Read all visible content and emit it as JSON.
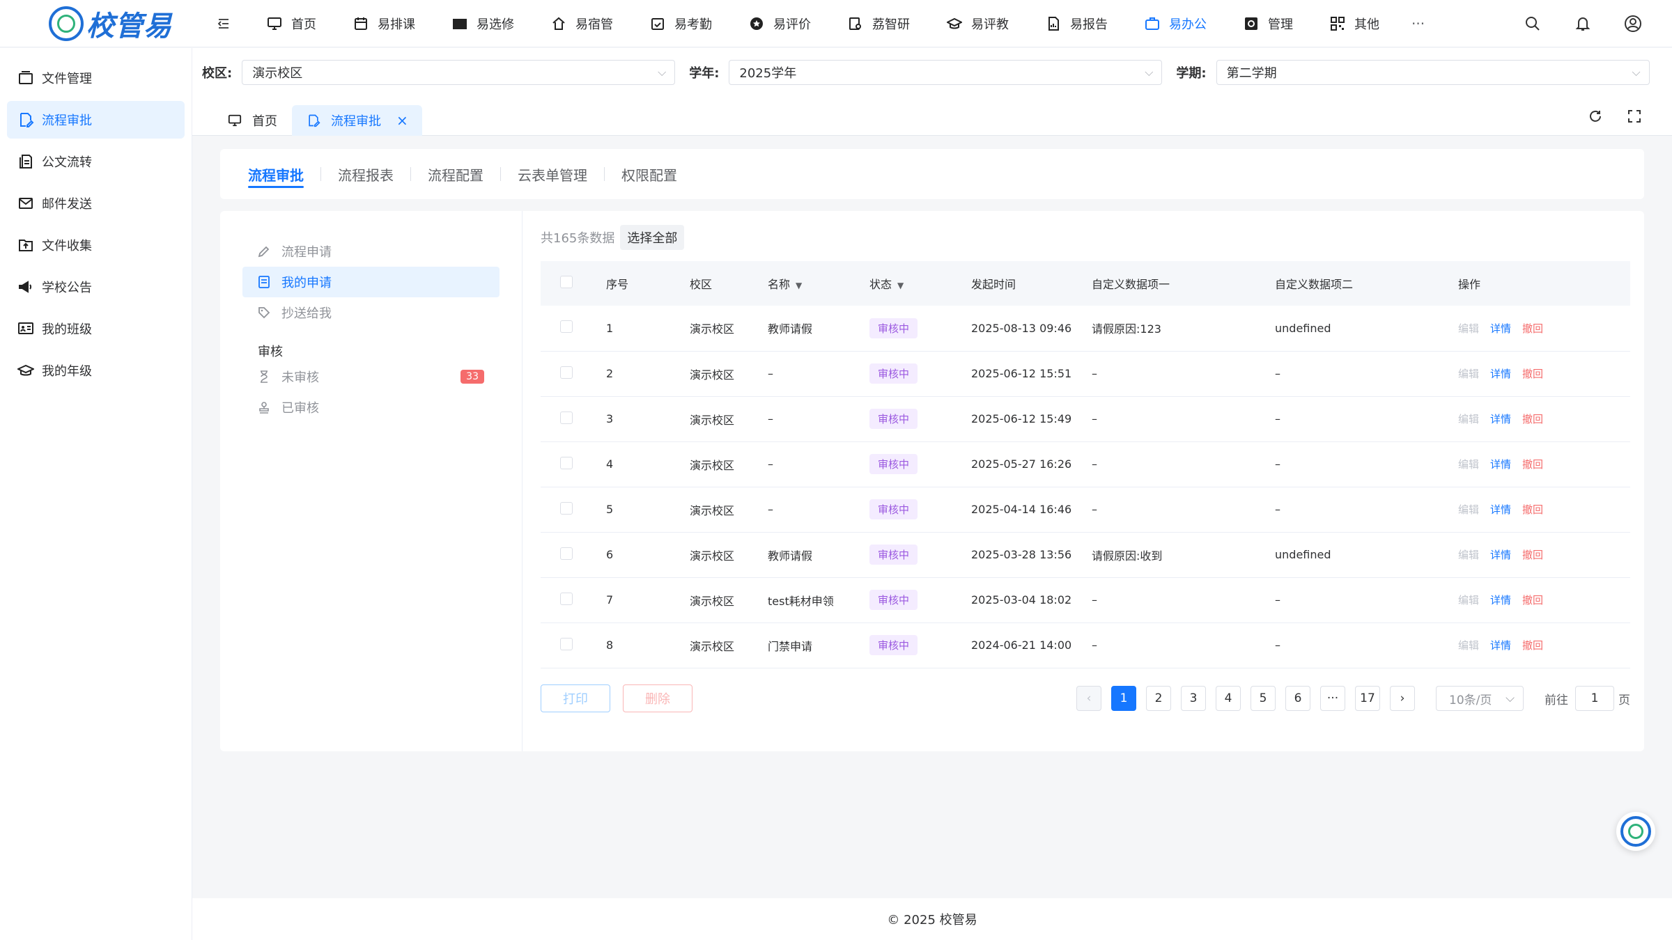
{
  "app": {
    "logo_text": "校管易",
    "accent": "#1677ff"
  },
  "nav": [
    {
      "label": "首页",
      "icon": "monitor-icon"
    },
    {
      "label": "易排课",
      "icon": "calendar-icon"
    },
    {
      "label": "易选修",
      "icon": "book-icon"
    },
    {
      "label": "易宿管",
      "icon": "dorm-icon"
    },
    {
      "label": "易考勤",
      "icon": "check-calendar-icon"
    },
    {
      "label": "易评价",
      "icon": "star-icon"
    },
    {
      "label": "荔智研",
      "icon": "research-icon"
    },
    {
      "label": "易评教",
      "icon": "graduation-cap-icon"
    },
    {
      "label": "易报告",
      "icon": "report-icon"
    },
    {
      "label": "易办公",
      "icon": "briefcase-icon",
      "active": true
    },
    {
      "label": "管理",
      "icon": "settings-box-icon"
    },
    {
      "label": "其他",
      "icon": "grid-icon"
    }
  ],
  "nav_more": "···",
  "sidebar": [
    {
      "label": "文件管理",
      "icon": "folder-icon"
    },
    {
      "label": "流程审批",
      "icon": "edit-document-icon",
      "active": true
    },
    {
      "label": "公文流转",
      "icon": "documents-icon"
    },
    {
      "label": "邮件发送",
      "icon": "mail-icon"
    },
    {
      "label": "文件收集",
      "icon": "folder-upload-icon"
    },
    {
      "label": "学校公告",
      "icon": "megaphone-icon"
    },
    {
      "label": "我的班级",
      "icon": "class-icon"
    },
    {
      "label": "我的年级",
      "icon": "graduation-cap-icon"
    }
  ],
  "filters": {
    "campus_label": "校区:",
    "campus_value": "演示校区",
    "year_label": "学年:",
    "year_value": "2025学年",
    "term_label": "学期:",
    "term_value": "第二学期"
  },
  "page_tabs": {
    "home": "首页",
    "current": "流程审批",
    "close": "×"
  },
  "subtabs": [
    "流程审批",
    "流程报表",
    "流程配置",
    "云表单管理",
    "权限配置"
  ],
  "left_menu": {
    "apply": "流程申请",
    "mine": "我的申请",
    "cc": "抄送给我",
    "group": "审核",
    "pending": "未审核",
    "pending_count": "33",
    "done": "已审核"
  },
  "list": {
    "count_text": "共165条数据",
    "select_all": "选择全部",
    "columns": [
      "序号",
      "校区",
      "名称",
      "状态",
      "发起时间",
      "自定义数据项一",
      "自定义数据项二",
      "操作"
    ],
    "rows": [
      {
        "no": "1",
        "campus": "演示校区",
        "name": "教师请假",
        "status": "审核中",
        "time": "2025-08-13 09:46",
        "c1": "请假原因:123",
        "c2": "undefined"
      },
      {
        "no": "2",
        "campus": "演示校区",
        "name": "–",
        "status": "审核中",
        "time": "2025-06-12 15:51",
        "c1": "–",
        "c2": "–"
      },
      {
        "no": "3",
        "campus": "演示校区",
        "name": "–",
        "status": "审核中",
        "time": "2025-06-12 15:49",
        "c1": "–",
        "c2": "–"
      },
      {
        "no": "4",
        "campus": "演示校区",
        "name": "–",
        "status": "审核中",
        "time": "2025-05-27 16:26",
        "c1": "–",
        "c2": "–"
      },
      {
        "no": "5",
        "campus": "演示校区",
        "name": "–",
        "status": "审核中",
        "time": "2025-04-14 16:46",
        "c1": "–",
        "c2": "–"
      },
      {
        "no": "6",
        "campus": "演示校区",
        "name": "教师请假",
        "status": "审核中",
        "time": "2025-03-28 13:56",
        "c1": "请假原因:收到",
        "c2": "undefined"
      },
      {
        "no": "7",
        "campus": "演示校区",
        "name": "test耗材申领",
        "status": "审核中",
        "time": "2025-03-04 18:02",
        "c1": "–",
        "c2": "–"
      },
      {
        "no": "8",
        "campus": "演示校区",
        "name": "门禁申请",
        "status": "审核中",
        "time": "2024-06-21 14:00",
        "c1": "–",
        "c2": "–"
      }
    ],
    "ops": {
      "edit": "编辑",
      "detail": "详情",
      "revoke": "撤回"
    }
  },
  "actions": {
    "print": "打印",
    "delete": "删除"
  },
  "pagination": {
    "pages": [
      "1",
      "2",
      "3",
      "4",
      "5",
      "6",
      "···",
      "17"
    ],
    "current": "1",
    "page_size": "10条/页",
    "goto_prefix": "前往",
    "goto_value": "1",
    "goto_suffix": "页"
  },
  "footer": "© 2025 校管易"
}
